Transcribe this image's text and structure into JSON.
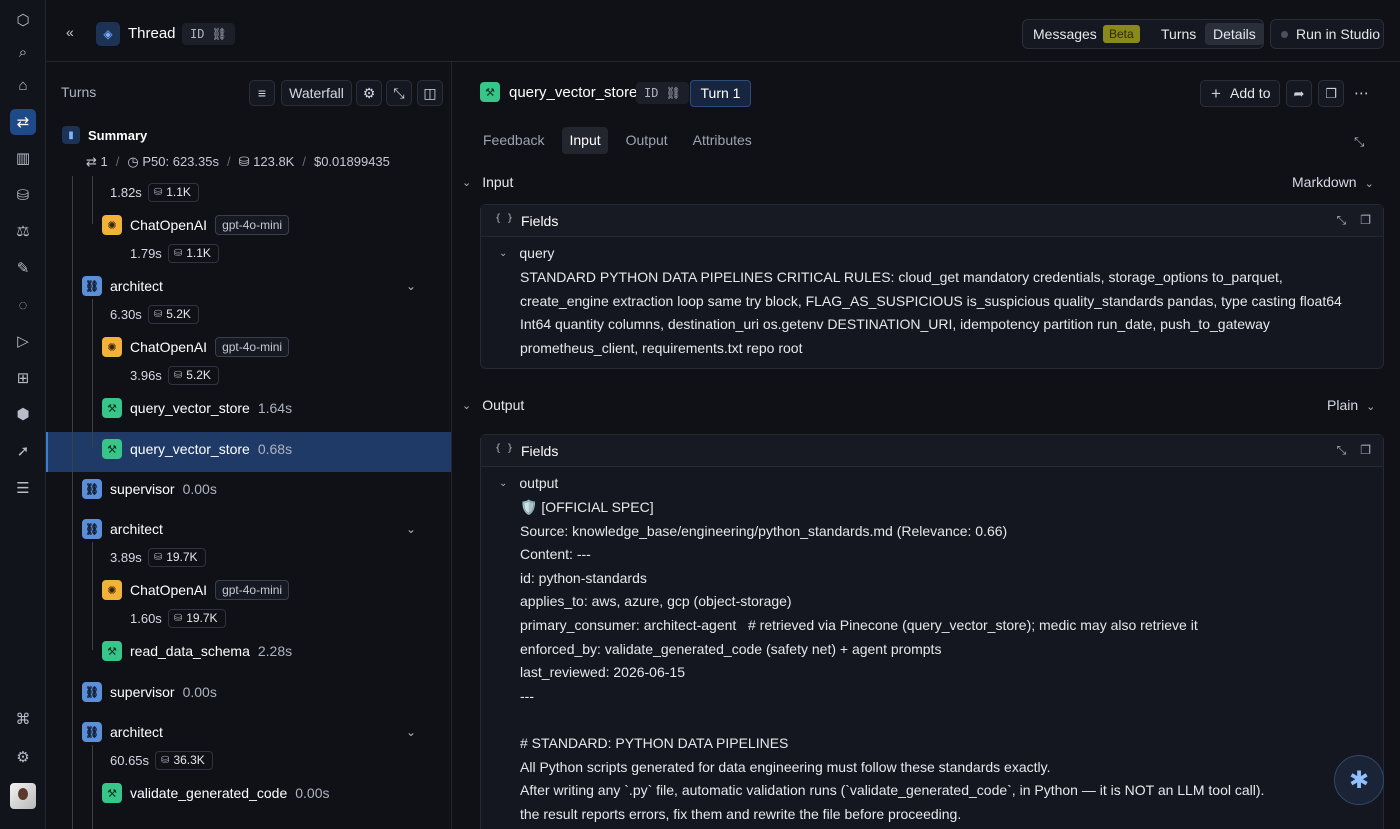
{
  "rail": {
    "icons": [
      "logo-icon",
      "search-icon",
      "home-icon",
      "threads-icon",
      "dashboards-icon",
      "datasets-icon",
      "experiments-icon",
      "annotations-icon",
      "chat-icon",
      "runs-icon",
      "tracing-icon",
      "deploy-icon",
      "rocket-icon",
      "storage-icon",
      "command-icon",
      "settings-icon"
    ]
  },
  "topbar": {
    "title": "Thread",
    "id_label": "ID",
    "tabs": {
      "messages": "Messages",
      "beta": "Beta",
      "turns": "Turns",
      "details": "Details"
    },
    "run_in_studio": "Run in Studio"
  },
  "left": {
    "heading": "Turns",
    "waterfall": "Waterfall",
    "summary": {
      "label": "Summary",
      "turns": "1",
      "p50": "P50: 623.35s",
      "tokens": "123.8K",
      "cost": "$0.01899435"
    },
    "tree": [
      {
        "kind": "meta",
        "dur": "1.82s",
        "tok": "1.1K"
      },
      {
        "kind": "llm",
        "name": "ChatOpenAI",
        "model": "gpt-4o-mini"
      },
      {
        "kind": "meta",
        "dur": "1.79s",
        "tok": "1.1K"
      },
      {
        "kind": "chain",
        "name": "architect"
      },
      {
        "kind": "meta",
        "dur": "6.30s",
        "tok": "5.2K"
      },
      {
        "kind": "llm",
        "name": "ChatOpenAI",
        "model": "gpt-4o-mini"
      },
      {
        "kind": "meta",
        "dur": "3.96s",
        "tok": "5.2K"
      },
      {
        "kind": "tool",
        "name": "query_vector_store",
        "dur": "1.64s"
      },
      {
        "kind": "tool",
        "name": "query_vector_store",
        "dur": "0.68s"
      },
      {
        "kind": "chain",
        "name": "supervisor",
        "dur": "0.00s"
      },
      {
        "kind": "chain",
        "name": "architect"
      },
      {
        "kind": "meta",
        "dur": "3.89s",
        "tok": "19.7K"
      },
      {
        "kind": "llm",
        "name": "ChatOpenAI",
        "model": "gpt-4o-mini"
      },
      {
        "kind": "meta",
        "dur": "1.60s",
        "tok": "19.7K"
      },
      {
        "kind": "tool",
        "name": "read_data_schema",
        "dur": "2.28s"
      },
      {
        "kind": "chain",
        "name": "supervisor",
        "dur": "0.00s"
      },
      {
        "kind": "chain",
        "name": "architect"
      },
      {
        "kind": "meta",
        "dur": "60.65s",
        "tok": "36.3K"
      },
      {
        "kind": "tool",
        "name": "validate_generated_code",
        "dur": "0.00s"
      }
    ]
  },
  "right": {
    "title": "query_vector_store",
    "id_label": "ID",
    "turn": "Turn 1",
    "add_to": "Add to",
    "tabs": [
      "Feedback",
      "Input",
      "Output",
      "Attributes"
    ],
    "input": {
      "heading": "Input",
      "format": "Markdown",
      "card_title": "Fields",
      "field": "query",
      "value": "STANDARD PYTHON DATA PIPELINES CRITICAL RULES: cloud_get mandatory credentials, storage_options to_parquet, create_engine extraction loop same try block, FLAG_AS_SUSPICIOUS is_suspicious quality_standards pandas, type casting float64 Int64 quantity columns, destination_uri os.getenv DESTINATION_URI, idempotency partition run_date, push_to_gateway prometheus_client, requirements.txt repo root"
    },
    "output": {
      "heading": "Output",
      "format": "Plain",
      "card_title": "Fields",
      "field": "output",
      "value": "🛡️ [OFFICIAL SPEC]\nSource: knowledge_base/engineering/python_standards.md (Relevance: 0.66)\nContent: ---\nid: python-standards\napplies_to: aws, azure, gcp (object-storage)\nprimary_consumer: architect-agent   # retrieved via Pinecone (query_vector_store); medic may also retrieve it\nenforced_by: validate_generated_code (safety net) + agent prompts\nlast_reviewed: 2026-06-15\n---\n\n# STANDARD: PYTHON DATA PIPELINES\nAll Python scripts generated for data engineering must follow these standards exactly.\nAfter writing any `.py` file, automatic validation runs (`validate_generated_code`, in Python — it is NOT an LLM tool call).\nthe result reports errors, fix them and rewrite the file before proceeding."
    }
  }
}
